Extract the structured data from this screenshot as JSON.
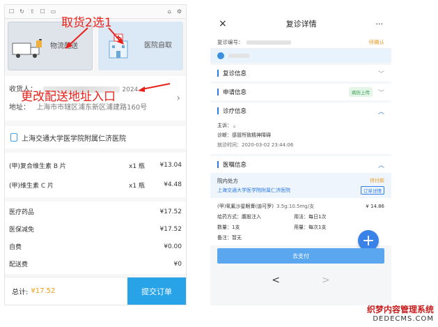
{
  "left": {
    "options": [
      {
        "label": "物流配送"
      },
      {
        "label": "医院自取"
      }
    ],
    "address": {
      "recipient_label": "收货人：",
      "recipient_value": "2024",
      "address_label": "地址：",
      "address_value": "上海市市辖区浦东新区浦建路160号"
    },
    "hospital": "上海交通大学医学院附属仁济医院",
    "medicines": [
      {
        "name": "(甲)复合维生素 B 片",
        "qty": "x1 瓶",
        "price": "¥13.04"
      },
      {
        "name": "(甲)维生素 C 片",
        "qty": "x1 瓶",
        "price": "¥4.48"
      }
    ],
    "fees": [
      {
        "name": "医疗药品",
        "value": "¥17.52"
      },
      {
        "name": "医保减免",
        "value": "¥17.52"
      },
      {
        "name": "自费",
        "value": "¥0.00"
      },
      {
        "name": "配送费",
        "value": "¥0"
      }
    ],
    "total_label": "总计:",
    "total_value": "¥17.52",
    "submit_label": "提交订单"
  },
  "annotations": {
    "pick": "取货2选1",
    "change": "更改配送地址入口"
  },
  "right": {
    "title": "复诊详情",
    "close_icon": "×",
    "more_icon": "···",
    "record_label": "复诊编号：",
    "record_status": "待确认",
    "sections": {
      "revisit": "复诊信息",
      "apply": "申请信息",
      "apply_tag": "病历上传",
      "diag": "诊疗信息",
      "advice": "医嘱信息"
    },
    "diag_info": {
      "complaint": "主诉：  。",
      "diagnosis": "诊断：感冒所致精神障碍",
      "time": "就诊时间：2020-03-02 23:44:06"
    },
    "rx": {
      "title": "院内处方",
      "status": "待付款",
      "hospital": "上海交通大学医学院附属仁济医院",
      "detail_btn": "订单详情",
      "drug": "(甲)氧氟沙星眼膏(迪可罗)",
      "spec": "3.5g:10.5mg/支",
      "price": "¥ 14.86",
      "route": "给药方式：腹股注入",
      "usage": "用法：每日1次",
      "amount": "数量：1支",
      "dosage": "用量：每次1支",
      "note": "备注：暂无"
    },
    "pay_label": "去支付",
    "nav_prev": "<",
    "nav_next": ">"
  },
  "watermark": {
    "line1": "织梦内容管理系统",
    "line2": "DEDECMS.COM"
  }
}
